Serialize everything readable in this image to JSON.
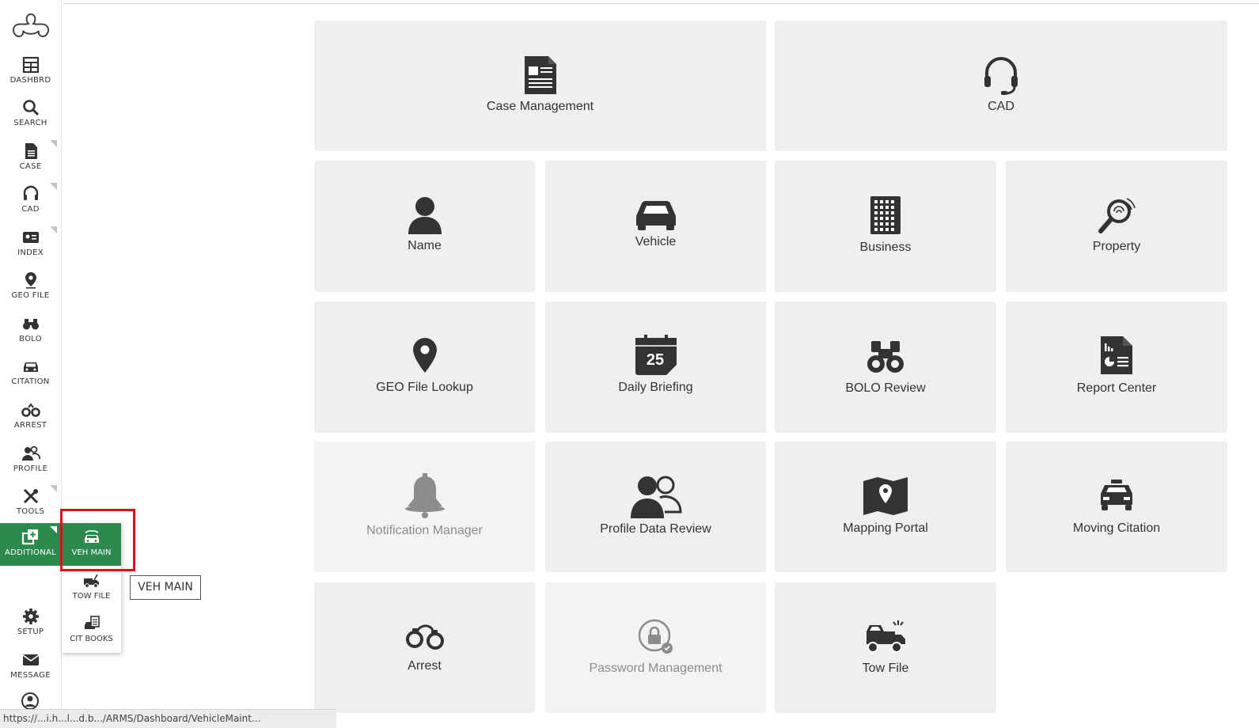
{
  "sidebar": {
    "items": [
      {
        "label": "DASHBRD",
        "icon": "dashboard-grid-icon"
      },
      {
        "label": "SEARCH",
        "icon": "search-icon"
      },
      {
        "label": "CASE",
        "icon": "document-icon"
      },
      {
        "label": "CAD",
        "icon": "headset-icon"
      },
      {
        "label": "INDEX",
        "icon": "index-card-icon"
      },
      {
        "label": "GEO FILE",
        "icon": "map-pin-icon"
      },
      {
        "label": "BOLO",
        "icon": "binoculars-icon"
      },
      {
        "label": "CITATION",
        "icon": "car-icon"
      },
      {
        "label": "ARREST",
        "icon": "handcuffs-icon"
      },
      {
        "label": "PROFILE",
        "icon": "profile-users-icon"
      },
      {
        "label": "TOOLS",
        "icon": "tools-icon"
      },
      {
        "label": "ADDITIONAL",
        "icon": "add-module-icon"
      },
      {
        "label": "SETUP",
        "icon": "gear-icon"
      },
      {
        "label": "MESSAGE",
        "icon": "envelope-icon"
      }
    ]
  },
  "flyout": {
    "items": [
      {
        "label": "VEH MAIN",
        "icon": "vehicle-maintenance-icon"
      },
      {
        "label": "TOW FILE",
        "icon": "tow-truck-icon"
      },
      {
        "label": "CIT BOOKS",
        "icon": "citation-books-icon"
      }
    ],
    "tooltip": "VEH MAIN"
  },
  "tiles": [
    {
      "label": "Case Management",
      "icon": "case-document-icon"
    },
    {
      "label": "CAD",
      "icon": "headset-icon"
    },
    {
      "label": "Name",
      "icon": "person-icon"
    },
    {
      "label": "Vehicle",
      "icon": "car-icon"
    },
    {
      "label": "Business",
      "icon": "building-icon"
    },
    {
      "label": "Property",
      "icon": "magnifier-fingerprint-icon"
    },
    {
      "label": "GEO File Lookup",
      "icon": "map-pin-icon"
    },
    {
      "label": "Daily Briefing",
      "icon": "calendar-icon",
      "day": "25"
    },
    {
      "label": "BOLO Review",
      "icon": "binoculars-icon"
    },
    {
      "label": "Report Center",
      "icon": "report-icon"
    },
    {
      "label": "Notification Manager",
      "icon": "bell-icon"
    },
    {
      "label": "Profile Data Review",
      "icon": "profile-users-icon"
    },
    {
      "label": "Mapping Portal",
      "icon": "map-icon"
    },
    {
      "label": "Moving Citation",
      "icon": "police-car-icon"
    },
    {
      "label": "Arrest",
      "icon": "handcuffs-icon"
    },
    {
      "label": "Password Management",
      "icon": "lock-icon"
    },
    {
      "label": "Tow File",
      "icon": "tow-truck-icon"
    }
  ],
  "statusbar": {
    "url": "https://...i.h...l...d.b.../ARMS/Dashboard/VehicleMaint..."
  }
}
